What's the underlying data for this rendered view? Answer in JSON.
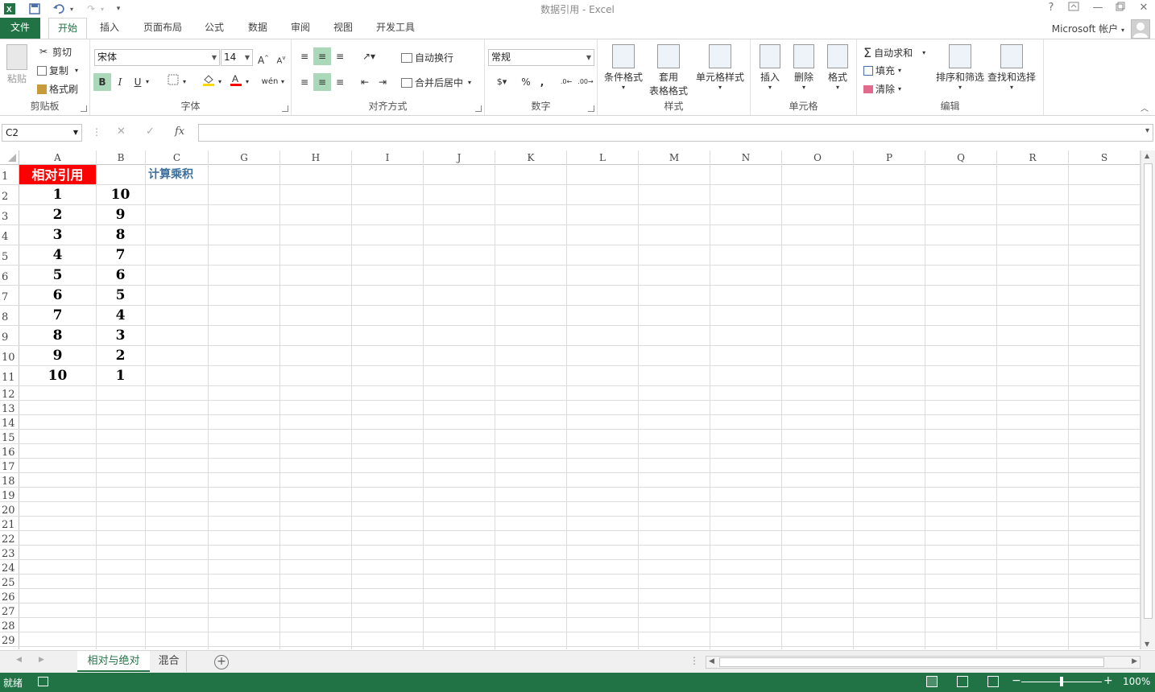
{
  "window": {
    "title": "数据引用 - Excel",
    "help": "?",
    "restore_icon_label": "□",
    "minimize": "—",
    "close": "✕"
  },
  "tabs": {
    "file": "文件",
    "items": [
      "开始",
      "插入",
      "页面布局",
      "公式",
      "数据",
      "审阅",
      "视图",
      "开发工具"
    ],
    "account": "Microsoft 帐户"
  },
  "ribbon": {
    "clipboard": {
      "paste": "粘贴",
      "cut": "剪切",
      "copy": "复制",
      "format_painter": "格式刷",
      "label": "剪贴板"
    },
    "font": {
      "name": "宋体",
      "size": "14",
      "bold": "B",
      "italic": "I",
      "underline": "U",
      "grow": "A",
      "shrink": "A",
      "phonetic": "wén",
      "label": "字体"
    },
    "alignment": {
      "wrap": "自动换行",
      "merge": "合并后居中",
      "label": "对齐方式"
    },
    "number": {
      "format": "常规",
      "percent": "%",
      "comma": ",",
      "label": "数字"
    },
    "styles": {
      "conditional": "条件格式",
      "table_line1": "套用",
      "table_line2": "表格格式",
      "cell_styles": "单元格样式",
      "label": "样式"
    },
    "cells": {
      "insert": "插入",
      "delete": "删除",
      "format": "格式",
      "label": "单元格"
    },
    "editing": {
      "autosum": "自动求和",
      "fill": "填充",
      "clear": "清除",
      "sort": "排序和筛选",
      "find": "查找和选择",
      "label": "编辑"
    }
  },
  "formula_bar": {
    "name_box": "C2",
    "fx": "fx",
    "value": ""
  },
  "sheet": {
    "columns": [
      "A",
      "B",
      "C",
      "G",
      "H",
      "I",
      "J",
      "K",
      "L",
      "M",
      "N",
      "O",
      "P",
      "Q",
      "R",
      "S"
    ],
    "rows": [
      "1",
      "2",
      "3",
      "4",
      "5",
      "6",
      "7",
      "8",
      "9",
      "10",
      "11",
      "12",
      "13",
      "14",
      "15",
      "16",
      "17",
      "18",
      "19",
      "20",
      "21",
      "22",
      "23",
      "24",
      "25",
      "26",
      "27",
      "28",
      "29"
    ],
    "header_a1": "相对引用",
    "header_c1": "计算乘积",
    "col_a": [
      "1",
      "2",
      "3",
      "4",
      "5",
      "6",
      "7",
      "8",
      "9",
      "10"
    ],
    "col_b": [
      "10",
      "9",
      "8",
      "7",
      "6",
      "5",
      "4",
      "3",
      "2",
      "1"
    ]
  },
  "sheet_tabs": {
    "active": "相对与绝对",
    "other": "混合"
  },
  "status": {
    "ready": "就绪",
    "zoom": "100%"
  },
  "colors": {
    "accent": "#217346",
    "header_fill": "#ff0000",
    "header_c1": "#3b6f9e"
  }
}
